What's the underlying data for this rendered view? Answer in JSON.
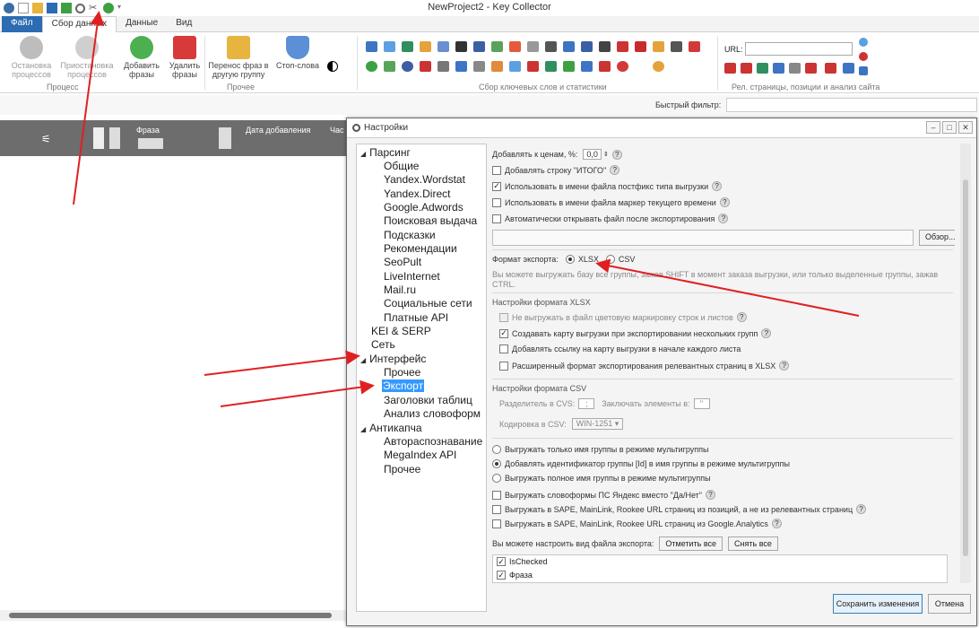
{
  "window": {
    "title": "NewProject2 - Key Collector"
  },
  "tabs": [
    {
      "label": "Файл"
    },
    {
      "label": "Сбор данных"
    },
    {
      "label": "Данные"
    },
    {
      "label": "Вид"
    }
  ],
  "ribbon": {
    "stop_label": "Остановка процессов",
    "pause_label": "Приостановка процессов",
    "add_label": "Добавить фразы",
    "delete_label": "Удалить фразы",
    "group_process": "Процесс",
    "move_label": "Перенос фраз в другую группу",
    "stopwords_label": "Стоп-слова",
    "group_other": "Прочее",
    "group_collect": "Сбор ключевых слов и статистики",
    "url_label": "URL:",
    "group_rel": "Рел. страницы, позиции и анализ сайта"
  },
  "filter": {
    "label": "Быстрый фильтр:"
  },
  "grid": {
    "col_phrase": "Фраза",
    "col_date": "Дата добавления",
    "col_freq": "Час"
  },
  "dialog": {
    "title": "Настройки",
    "tree": [
      {
        "label": "Парсинг",
        "expanded": true
      },
      {
        "label": "Общие"
      },
      {
        "label": "Yandex.Wordstat"
      },
      {
        "label": "Yandex.Direct"
      },
      {
        "label": "Google.Adwords"
      },
      {
        "label": "Поисковая выдача"
      },
      {
        "label": "Подсказки"
      },
      {
        "label": "Рекомендации"
      },
      {
        "label": "SeoPult"
      },
      {
        "label": "LiveInternet"
      },
      {
        "label": "Mail.ru"
      },
      {
        "label": "Социальные сети"
      },
      {
        "label": "Платные API"
      },
      {
        "label": "KEI & SERP"
      },
      {
        "label": "Сеть"
      },
      {
        "label": "Интерфейс",
        "expanded": true
      },
      {
        "label": "Прочее"
      },
      {
        "label": "Экспорт",
        "selected": true
      },
      {
        "label": "Заголовки таблиц"
      },
      {
        "label": "Анализ словоформ"
      },
      {
        "label": "Антикапча",
        "expanded": true
      },
      {
        "label": "Автораспознавание"
      },
      {
        "label": "MegaIndex API"
      },
      {
        "label": "Прочее"
      }
    ],
    "price_label": "Добавлять к ценам, %:",
    "price_value": "0,0",
    "opt_total": "Добавлять строку \"ИТОГО\"",
    "opt_postfix": "Использовать в имени файла постфикс типа выгрузки",
    "opt_timemarker": "Использовать в имени файла маркер текущего времени",
    "opt_autoopen": "Автоматически открывать файл после экспортирования",
    "browse_button": "Обзор...",
    "format_label": "Формат экспорта:",
    "format_xlsx": "XLSX",
    "format_csv": "CSV",
    "hint_text": "Вы можете выгружать базу все группы, зажав SHIFT в момент заказа выгрузки, или только выделенные группы, зажав CTRL.",
    "xlsx_section": "Настройки формата XLSX",
    "xlsx_opt1": "Не выгружать в файл цветовую маркировку строк и листов",
    "xlsx_opt2": "Создавать карту выгрузки при экспортировании нескольких групп",
    "xlsx_opt3": "Добавлять ссылку на карту выгрузки в начале каждого листа",
    "xlsx_opt4": "Расширенный формат экспортирования релевантных страниц в XLSX",
    "csv_section": "Настройки формата CSV",
    "csv_sep_label": "Разделитель в CVS:",
    "csv_sep_value": ";",
    "csv_quote_label": "Заключать элементы в:",
    "csv_quote_value": "\"",
    "csv_enc_label": "Кодировка в CSV:",
    "csv_enc_value": "WIN-1251",
    "radio1": "Выгружать только имя группы в режиме мультигруппы",
    "radio2": "Добавлять идентификатор группы [Id] в имя группы в режиме мультигруппы",
    "radio3": "Выгружать полное имя группы в режиме мультигруппы",
    "opt_wordforms": "Выгружать словоформы ПС Яндекс вместо \"Да/Нет\"",
    "opt_sape_pos": "Выгружать в SAPE, MainLink, Rookee URL страниц из позиций, а не из релевантных страниц",
    "opt_sape_ga": "Выгружать в SAPE, MainLink, Rookee URL страниц из Google.Analytics",
    "view_label": "Вы можете настроить вид файла экспорта:",
    "check_all": "Отметить все",
    "uncheck_all": "Снять все",
    "list": [
      "IsChecked",
      "Фраза"
    ],
    "save_button": "Сохранить изменения",
    "cancel_button": "Отмена"
  },
  "colors": {
    "accent": "#2b6cb3",
    "arrow": "#e02020",
    "selection": "#3399ff"
  }
}
